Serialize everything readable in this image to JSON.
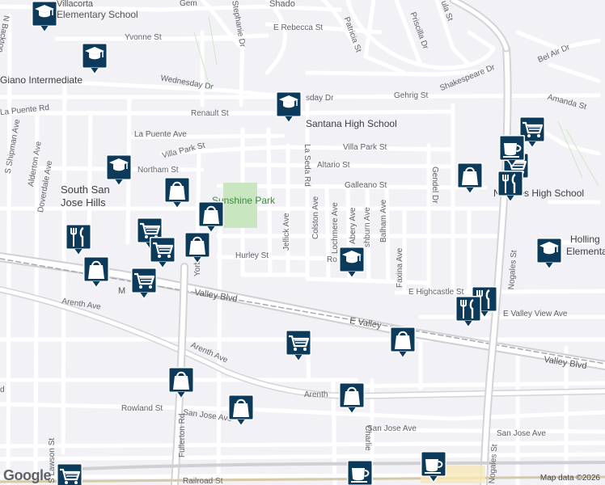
{
  "map": {
    "attribution_logo": "Google",
    "attribution": "Map data ©2026"
  },
  "places": {
    "villacorta": "Villacorta",
    "villacorta_school": "Elementary School",
    "giano": "Giano Intermediate",
    "santana": "Santana High School",
    "south_san": "South San",
    "jose_hills": "Jose Hills",
    "sunshine_park": "Sunshine Park",
    "nogales_hs": "Nogales High School",
    "holling": "Holling",
    "holling_school": "Elementary Scho"
  },
  "streets": {
    "gem": "Gem",
    "shadow": "Shado",
    "e_rebecca": "E Rebecca St",
    "patricia": "Patricia St",
    "priscilla": "Priscilla Dr",
    "paula": "ula St",
    "shakespeare": "Shakespeare Dr",
    "bel_air": "Bel Air Dr",
    "yvonne": "Yvonne St",
    "stephanie": "Stephanie Dr",
    "n_backton": "N Backton",
    "wednesday": "Wednesday Dr",
    "wednesday2": "sday Dr",
    "gehrig": "Gehrig St",
    "amanda": "Amanda St",
    "renault": "Renault St",
    "la_puente_ave": "La Puente Ave",
    "la_puente_rd": "La Puente Rd",
    "s_shipman": "S Shipman Ave",
    "alderton": "Alderton Ave",
    "doverdale": "Doverdale Ave",
    "villa_park_w": "Villa Park St",
    "villa_park_e": "Villa Park St",
    "northam": "Northam St",
    "altario": "Altario St",
    "galleano": "Galleano St",
    "la_seda": "La Seda Rd",
    "gendel": "Gendel Dr",
    "jellick": "Jellick Ave",
    "colston": "Colston Ave",
    "lochmere": "Lochmere Ave",
    "abery": "Abery Ave",
    "ashburn": "shburn Ave",
    "balham": "Balham Ave",
    "faxina": "Faxina Ave",
    "nogales": "Nogales St",
    "hurley": "Hurley St",
    "rom": "Ro",
    "yorba": "Yorba",
    "e_highcastle": "E Highcastle St",
    "e_valley_view": "E Valley View Ave",
    "valley_blvd_w": "Valley Blvd",
    "valley_blvd_m": "E Valley",
    "valley_blvd_e": "Valley Blvd",
    "m": "M",
    "arenth_w": "Arenth Ave",
    "arenth_m": "Arenth Ave",
    "arenth_e": "Arenth",
    "fullerton": "Fullerton Rd",
    "ave_w": "d",
    "rowland": "Rowland St",
    "san_jose_w": "San Jose Ave",
    "san_jose_m": "San Jose Ave",
    "san_jose_e": "San Jose Ave",
    "s_lawson": "S Lawson St",
    "charlie": "Charlie",
    "railroad": "Railroad St",
    "nogales_s": "Nogales St"
  },
  "icons": {
    "school": "graduation-cap-icon",
    "shopping": "shopping-bag-icon",
    "grocery": "shopping-cart-icon",
    "restaurant": "fork-knife-icon",
    "cafe": "coffee-cup-icon"
  },
  "colors": {
    "pin_blue": "#0b3a5b",
    "background": "#f2f1f5",
    "road": "#ffffff",
    "major_road": "#d8d8dc",
    "park": "#c8e6c0",
    "rail": "#9aa0a6"
  }
}
